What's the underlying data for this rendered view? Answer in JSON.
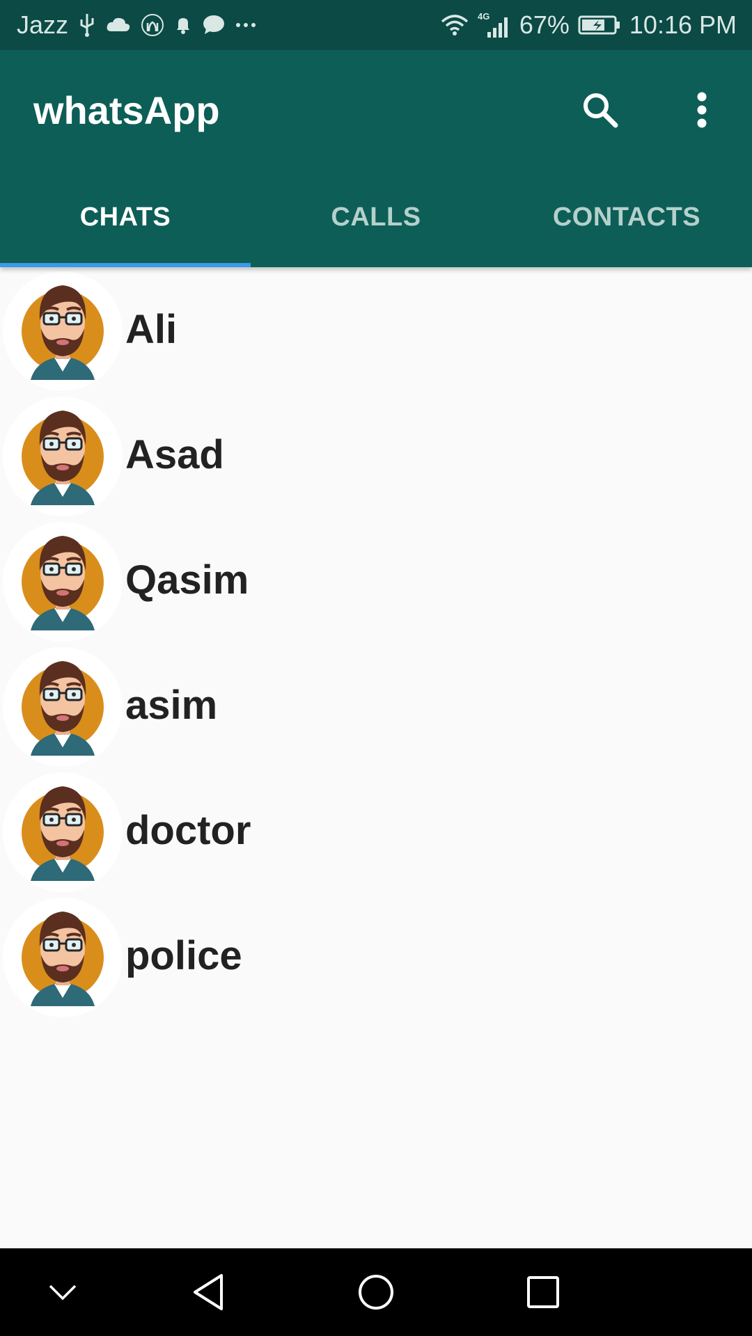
{
  "status_bar": {
    "carrier": "Jazz",
    "network_type": "4G",
    "battery": "67%",
    "time": "10:16 PM",
    "icons": [
      "usb-icon",
      "cloud-icon",
      "mosque-icon",
      "bell-icon",
      "message-icon",
      "more-dots-icon",
      "wifi-icon",
      "signal-icon",
      "battery-icon"
    ]
  },
  "toolbar": {
    "title": "whatsApp",
    "icons": [
      "search-icon",
      "more-vert-icon"
    ]
  },
  "tabs": [
    {
      "label": "CHATS",
      "active": true
    },
    {
      "label": "CALLS",
      "active": false
    },
    {
      "label": "CONTACTS",
      "active": false
    }
  ],
  "chats": [
    {
      "name": "Ali"
    },
    {
      "name": "Asad"
    },
    {
      "name": "Qasim"
    },
    {
      "name": "asim"
    },
    {
      "name": "doctor"
    },
    {
      "name": "police"
    }
  ],
  "nav_bar": {
    "icons": [
      "chevron-down-icon",
      "back-icon",
      "home-icon",
      "recents-icon"
    ]
  },
  "colors": {
    "status_bar": "#0b4a45",
    "toolbar": "#0d5e57",
    "tab_indicator": "#3b9ae8",
    "avatar_background": "#d98e1c"
  }
}
